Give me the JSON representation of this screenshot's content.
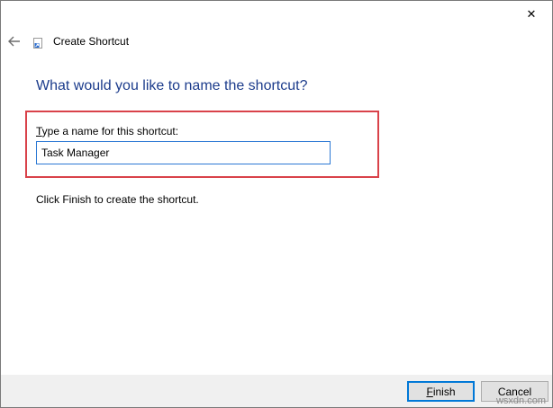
{
  "window": {
    "close_glyph": "✕"
  },
  "wizard": {
    "title": "Create Shortcut",
    "back_icon": "arrow-left-icon",
    "app_icon": "shortcut-icon"
  },
  "main": {
    "heading": "What would you like to name the shortcut?",
    "label_accel": "T",
    "label_rest": "ype a name for this shortcut:",
    "name_value": "Task Manager",
    "info": "Click Finish to create the shortcut."
  },
  "footer": {
    "finish_accel": "F",
    "finish_rest": "inish",
    "cancel_label": "Cancel"
  },
  "watermark": "wsxdn.com",
  "colors": {
    "heading": "#1c3c8c",
    "highlight": "#d9424a",
    "focus": "#0078d7"
  }
}
